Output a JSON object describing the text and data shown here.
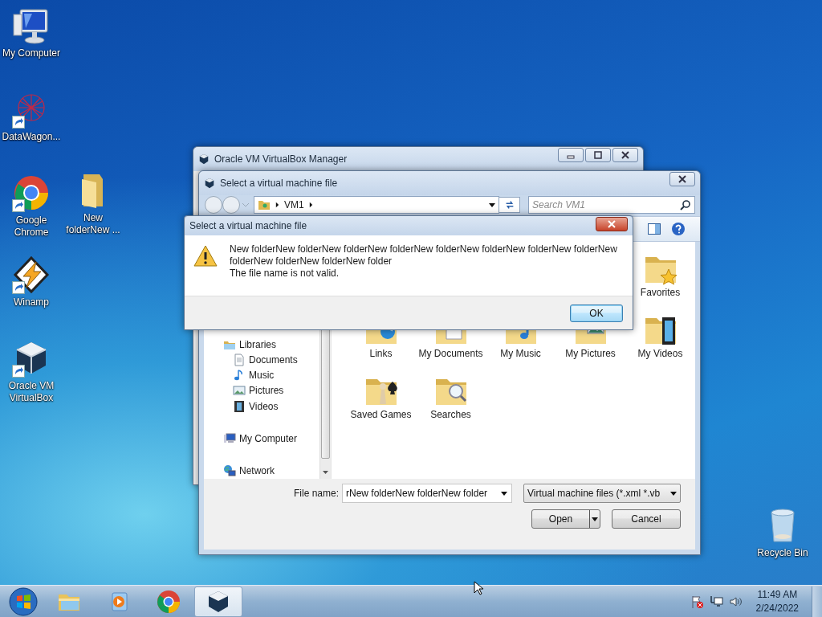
{
  "desktop_icons": [
    {
      "label": "My Computer",
      "kind": "computer",
      "shortcut": false
    },
    {
      "label": "DataWagon...",
      "kind": "web",
      "shortcut": true
    },
    {
      "label": "Google Chrome",
      "kind": "chrome",
      "shortcut": true
    },
    {
      "label": "New folderNew ...",
      "kind": "folder",
      "shortcut": false
    },
    {
      "label": "Winamp",
      "kind": "bolt",
      "shortcut": true
    },
    {
      "label": "Oracle VM VirtualBox",
      "kind": "cube",
      "shortcut": true
    },
    {
      "label": "Recycle Bin",
      "kind": "bin",
      "shortcut": false
    }
  ],
  "manager_window": {
    "title": "Oracle VM VirtualBox Manager"
  },
  "file_dialog": {
    "title": "Select a virtual machine file",
    "breadcrumb": [
      "VM1"
    ],
    "search": {
      "placeholder": "Search VM1"
    },
    "nav_pane": [
      {
        "label": "Libraries",
        "kind": "library",
        "children": [
          {
            "label": "Documents",
            "kind": "document"
          },
          {
            "label": "Music",
            "kind": "music"
          },
          {
            "label": "Pictures",
            "kind": "picture"
          },
          {
            "label": "Videos",
            "kind": "video"
          }
        ]
      },
      {
        "label": "My Computer",
        "kind": "computer"
      },
      {
        "label": "Network",
        "kind": "network"
      }
    ],
    "items": [
      {
        "label": "Favorites",
        "kind": "star"
      },
      {
        "label": "Links",
        "kind": "globe"
      },
      {
        "label": "My Documents",
        "kind": "document"
      },
      {
        "label": "My Music",
        "kind": "music"
      },
      {
        "label": "My Pictures",
        "kind": "picture"
      },
      {
        "label": "My Videos",
        "kind": "video"
      },
      {
        "label": "Saved Games",
        "kind": "game"
      },
      {
        "label": "Searches",
        "kind": "search"
      }
    ],
    "file_name": {
      "label": "File name:",
      "value": "rNew folderNew folderNew folder"
    },
    "file_type": "Virtual machine files (*.xml *.vb",
    "buttons": [
      {
        "label": "Open",
        "kind": "split"
      },
      {
        "label": "Cancel",
        "kind": "plain"
      }
    ]
  },
  "message_box": {
    "title": "Select a virtual machine file",
    "message": "New folderNew folderNew folderNew folderNew folderNew folderNew folderNew folderNew folderNew folderNew folderNew folder",
    "detail": "The file name is not valid.",
    "buttons": [
      "OK"
    ]
  },
  "taskbar": {
    "items": [
      {
        "kind": "explorer",
        "active": false
      },
      {
        "kind": "media",
        "active": false
      },
      {
        "kind": "chrome",
        "active": false
      },
      {
        "kind": "cube",
        "active": true
      }
    ],
    "clock": {
      "time": "11:49 AM",
      "date": "2/24/2022"
    }
  }
}
